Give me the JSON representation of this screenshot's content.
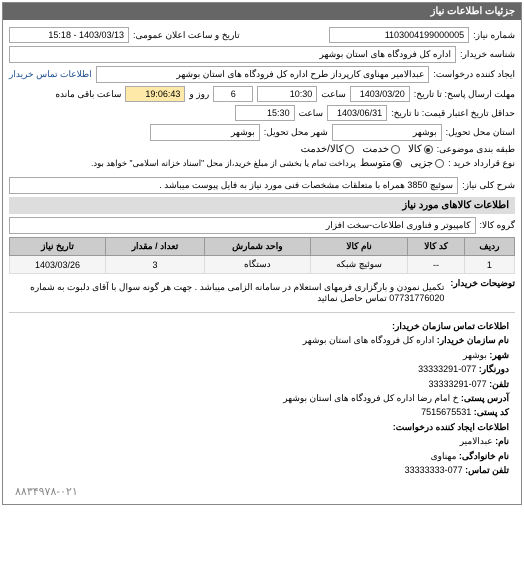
{
  "panel_title": "جزئیات اطلاعات نیاز",
  "fields": {
    "need_no_label": "شماره نیاز:",
    "need_no": "1103004199000005",
    "pub_dt_label": "تاریخ و ساعت اعلان عمومی:",
    "pub_dt": "1403/03/13 - 15:18",
    "buyer_label": "شناسه خریدار:",
    "buyer": "اداره کل فرودگاه های استان بوشهر",
    "creator_label": "ایجاد کننده درخواست:",
    "creator": "عبدالامیر مهناوی کارپرداز طرح اداره کل فرودگاه های استان بوشهر",
    "creator_contact_label": "اطلاعات تماس خریدار",
    "deadline_to_label": "مهلت ارسال پاسخ: تا تاریخ:",
    "deadline_date": "1403/03/20",
    "time_label": "ساعت",
    "deadline_time": "10:30",
    "remain_days": "6",
    "remain_days_label": "روز و",
    "remain_time": "19:06:43",
    "remain_time_label": "ساعت باقی مانده",
    "validity_label": "حداقل تاریخ اعتبار قیمت: تا تاریخ:",
    "validity_date": "1403/06/31",
    "validity_time": "15:30",
    "delivery_prov_label": "استان محل تحویل:",
    "delivery_prov": "بوشهر",
    "delivery_city_label": "شهر محل تحویل:",
    "delivery_city": "بوشهر",
    "budget_type_label": "طبقه بندی موضوعی:",
    "budget_opts": {
      "o1": "کالا",
      "o2": "خدمت",
      "o3": "کالا/خدمت"
    },
    "pay_type_label": "نوع قرارداد خرید :",
    "pay_opts": {
      "o1": "جزیی",
      "o2": "متوسط"
    },
    "pay_note": "پرداخت تمام یا بخشی از مبلغ خرید،از محل \"اسناد خزانه اسلامی\" خواهد بود.",
    "desc_label": "شرح کلی نیاز:",
    "desc": "سوئیچ 3850 همراه با متعلقات مشخصات فنی مورد نیاز به فایل پیوست میباشد .",
    "goods_section": "اطلاعات کالاهای مورد نیاز",
    "goods_group_label": "گروه کالا:",
    "goods_group": "کامپیوتر و فناوری اطلاعات-سخت افزار"
  },
  "table": {
    "headers": [
      "ردیف",
      "کد کالا",
      "نام کالا",
      "واحد شمارش",
      "تعداد / مقدار",
      "تاریخ نیاز"
    ],
    "row": [
      "1",
      "--",
      "سوئیچ شبکه",
      "دستگاه",
      "3",
      "1403/03/26"
    ]
  },
  "buyer_note_label": "توضیحات خریدار:",
  "buyer_note": "تکمیل نمودن و بارگزاری فرمهای استعلام در سامانه الزامی میباشد . جهت هر گونه سوال با آقای دلبوت به شماره 07731776020 تماس حاصل نمائید",
  "contact_section": "اطلاعات تماس سازمان خریدار:",
  "contact": {
    "org_label": "نام سازمان خریدار:",
    "org": "اداره کل فرودگاه های استان بوشهر",
    "city_label": "شهر:",
    "city": "بوشهر",
    "fax_label": "دورنگار:",
    "fax": "077-33333291",
    "tel_label": "تلفن:",
    "tel": "077-33333291",
    "addr_label": "آدرس پستی:",
    "addr": "خ امام رضا اداره کل فرودگاه های استان بوشهر",
    "zip_label": "کد پستی:",
    "zip": "7515675531",
    "creator_section": "اطلاعات ایجاد کننده درخواست:",
    "name_label": "نام:",
    "name": "عبدالامیر",
    "family_label": "نام خانوادگی:",
    "family": "مهناوی",
    "phone_label": "تلفن تماس:",
    "phone": "077-33333333"
  },
  "footer_phone": "۸۸۳۴۹۷۸-۰۲۱"
}
